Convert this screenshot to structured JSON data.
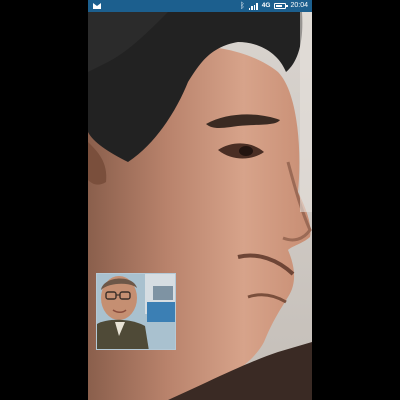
{
  "status_bar": {
    "notification_icon": "mail-icon",
    "bluetooth_icon": "bluetooth-icon",
    "signal_icon": "signal-icon",
    "network_type": "4G",
    "battery_icon": "battery-icon",
    "battery_level": 0.8,
    "time": "20:04",
    "background_color": "#1c5f8e"
  },
  "call": {
    "remote_video": "remote-participant-video",
    "self_preview": "self-camera-preview"
  }
}
